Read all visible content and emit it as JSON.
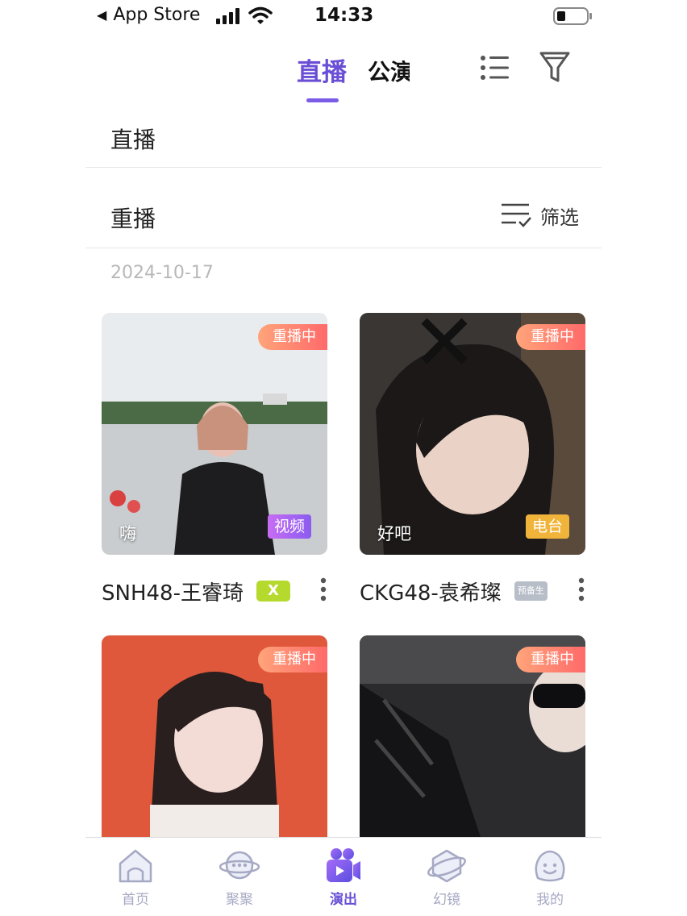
{
  "status_bar": {
    "back_label": "App Store",
    "time": "14:33"
  },
  "top_nav": {
    "tabs": [
      {
        "label": "直播",
        "active": true
      },
      {
        "label": "公演",
        "active": false
      }
    ],
    "accent_color": "#6a4fd6"
  },
  "sections": {
    "live_title": "直播",
    "replay_title": "重播",
    "filter_label": "筛选"
  },
  "date": "2024-10-17",
  "cards": [
    {
      "badge": "重播中",
      "type_label": "视频",
      "caption": "嗨",
      "member": "SNH48-王睿琦",
      "tag": "X"
    },
    {
      "badge": "重播中",
      "type_label": "电台",
      "caption": "好吧",
      "member": "CKG48-袁希璨",
      "tag": "预备生"
    },
    {
      "badge": "重播中"
    },
    {
      "badge": "重播中"
    }
  ],
  "bottom_nav": [
    {
      "label": "首页",
      "icon": "home-icon",
      "active": false
    },
    {
      "label": "聚聚",
      "icon": "chat-planet-icon",
      "active": false
    },
    {
      "label": "演出",
      "icon": "video-camera-icon",
      "active": true
    },
    {
      "label": "幻镜",
      "icon": "cube-planet-icon",
      "active": false
    },
    {
      "label": "我的",
      "icon": "smiley-icon",
      "active": false
    }
  ]
}
